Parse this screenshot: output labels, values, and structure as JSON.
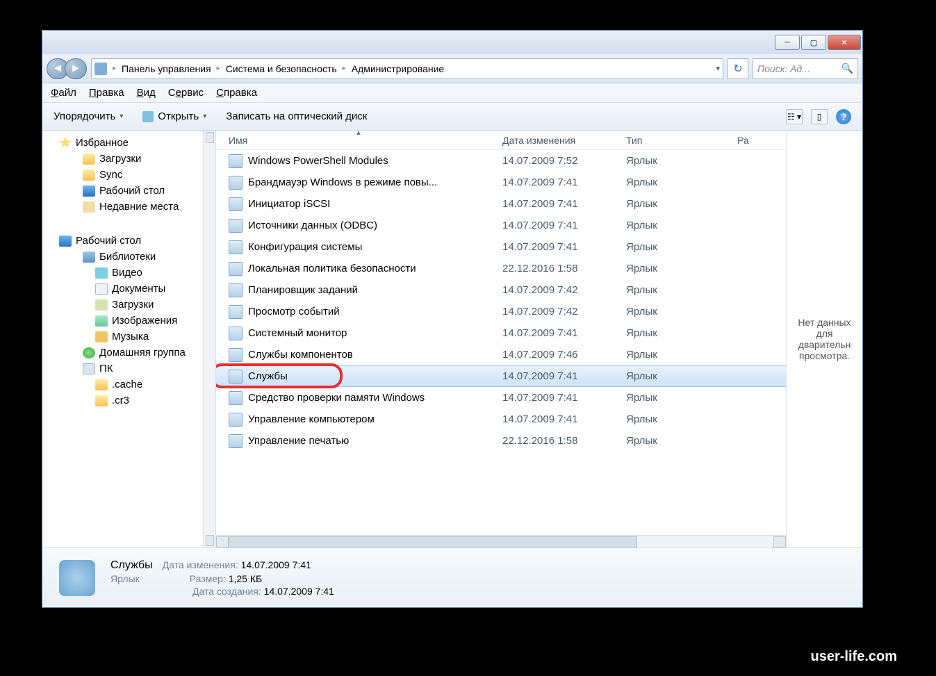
{
  "breadcrumbs": [
    "Панель управления",
    "Система и безопасность",
    "Администрирование"
  ],
  "search": {
    "placeholder": "Поиск: Ад..."
  },
  "menu": {
    "file": "Файл",
    "edit": "Правка",
    "view": "Вид",
    "tools": "Сервис",
    "help": "Справка"
  },
  "toolbar": {
    "organize": "Упорядочить",
    "open": "Открыть",
    "burn": "Записать на оптический диск"
  },
  "columns": {
    "name": "Имя",
    "date": "Дата изменения",
    "type": "Тип",
    "size": "Ра"
  },
  "nav": {
    "favorites": {
      "label": "Избранное",
      "items": [
        {
          "label": "Загрузки",
          "icon": "i-fold"
        },
        {
          "label": "Sync",
          "icon": "i-fold"
        },
        {
          "label": "Рабочий стол",
          "icon": "i-desk"
        },
        {
          "label": "Недавние места",
          "icon": "i-rec"
        }
      ]
    },
    "desktop": {
      "label": "Рабочий стол",
      "items": [
        {
          "label": "Библиотеки",
          "icon": "i-lib",
          "children": [
            {
              "label": "Видео",
              "icon": "i-vid"
            },
            {
              "label": "Документы",
              "icon": "i-doc"
            },
            {
              "label": "Загрузки",
              "icon": "i-down"
            },
            {
              "label": "Изображения",
              "icon": "i-img"
            },
            {
              "label": "Музыка",
              "icon": "i-mus"
            }
          ]
        },
        {
          "label": "Домашняя группа",
          "icon": "i-hg"
        },
        {
          "label": "ПК",
          "icon": "i-pc",
          "children": [
            {
              "label": ".cache",
              "icon": "i-fold"
            },
            {
              "label": ".cr3",
              "icon": "i-fold"
            }
          ]
        }
      ]
    }
  },
  "files": [
    {
      "name": "Windows PowerShell Modules",
      "date": "14.07.2009 7:52",
      "type": "Ярлык",
      "selected": false
    },
    {
      "name": "Брандмауэр Windows в режиме повы...",
      "date": "14.07.2009 7:41",
      "type": "Ярлык",
      "selected": false
    },
    {
      "name": "Инициатор iSCSI",
      "date": "14.07.2009 7:41",
      "type": "Ярлык",
      "selected": false
    },
    {
      "name": "Источники данных (ODBC)",
      "date": "14.07.2009 7:41",
      "type": "Ярлык",
      "selected": false
    },
    {
      "name": "Конфигурация системы",
      "date": "14.07.2009 7:41",
      "type": "Ярлык",
      "selected": false
    },
    {
      "name": "Локальная политика безопасности",
      "date": "22.12.2016 1:58",
      "type": "Ярлык",
      "selected": false
    },
    {
      "name": "Планировщик заданий",
      "date": "14.07.2009 7:42",
      "type": "Ярлык",
      "selected": false
    },
    {
      "name": "Просмотр событий",
      "date": "14.07.2009 7:42",
      "type": "Ярлык",
      "selected": false
    },
    {
      "name": "Системный монитор",
      "date": "14.07.2009 7:41",
      "type": "Ярлык",
      "selected": false
    },
    {
      "name": "Службы компонентов",
      "date": "14.07.2009 7:46",
      "type": "Ярлык",
      "selected": false
    },
    {
      "name": "Службы",
      "date": "14.07.2009 7:41",
      "type": "Ярлык",
      "selected": true
    },
    {
      "name": "Средство проверки памяти Windows",
      "date": "14.07.2009 7:41",
      "type": "Ярлык",
      "selected": false
    },
    {
      "name": "Управление компьютером",
      "date": "14.07.2009 7:41",
      "type": "Ярлык",
      "selected": false
    },
    {
      "name": "Управление печатью",
      "date": "22.12.2016 1:58",
      "type": "Ярлык",
      "selected": false
    }
  ],
  "preview": {
    "text": "Нет данных для дварительн просмотра."
  },
  "details": {
    "name": "Службы",
    "subtype": "Ярлык",
    "props": {
      "modified_label": "Дата изменения:",
      "modified": "14.07.2009 7:41",
      "size_label": "Размер:",
      "size": "1,25 КБ",
      "created_label": "Дата создания:",
      "created": "14.07.2009 7:41"
    }
  },
  "watermark": "user-life.com"
}
